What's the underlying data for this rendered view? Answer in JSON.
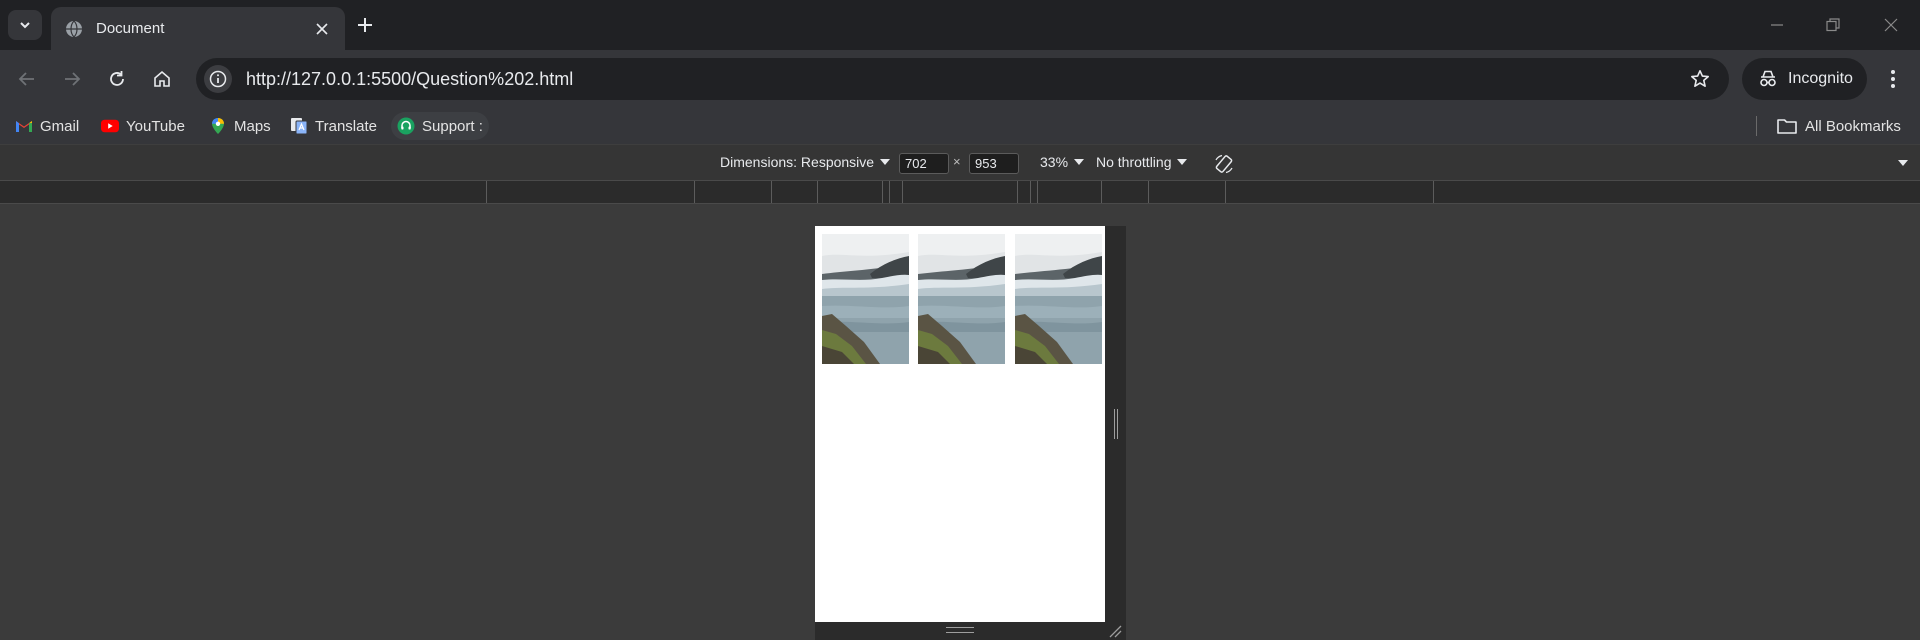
{
  "tab": {
    "title": "Document"
  },
  "address_bar": {
    "url": "http://127.0.0.1:5500/Question%202.html"
  },
  "profile": {
    "label": "Incognito"
  },
  "bookmarks": {
    "items": [
      {
        "label": "Gmail",
        "icon": "gmail-icon"
      },
      {
        "label": "YouTube",
        "icon": "youtube-icon"
      },
      {
        "label": "Maps",
        "icon": "maps-icon"
      },
      {
        "label": "Translate",
        "icon": "translate-icon"
      },
      {
        "label": "Support :",
        "icon": "support-icon"
      }
    ],
    "all_bookmarks": "All Bookmarks"
  },
  "device_toolbar": {
    "dimensions_label": "Dimensions: Responsive",
    "width": "702",
    "height": "953",
    "times": "×",
    "zoom": "33%",
    "throttling": "No throttling"
  },
  "page": {
    "images": [
      {
        "alt": "waterfall-photo",
        "icon": "waterfall-image"
      },
      {
        "alt": "waterfall-photo",
        "icon": "waterfall-image"
      },
      {
        "alt": "waterfall-photo",
        "icon": "waterfall-image"
      }
    ]
  },
  "colors": {
    "tabstrip_bg": "#202124",
    "toolbar_bg": "#35363a",
    "viewport_bg": "#3b3b3b",
    "page_bg": "#ffffff"
  }
}
